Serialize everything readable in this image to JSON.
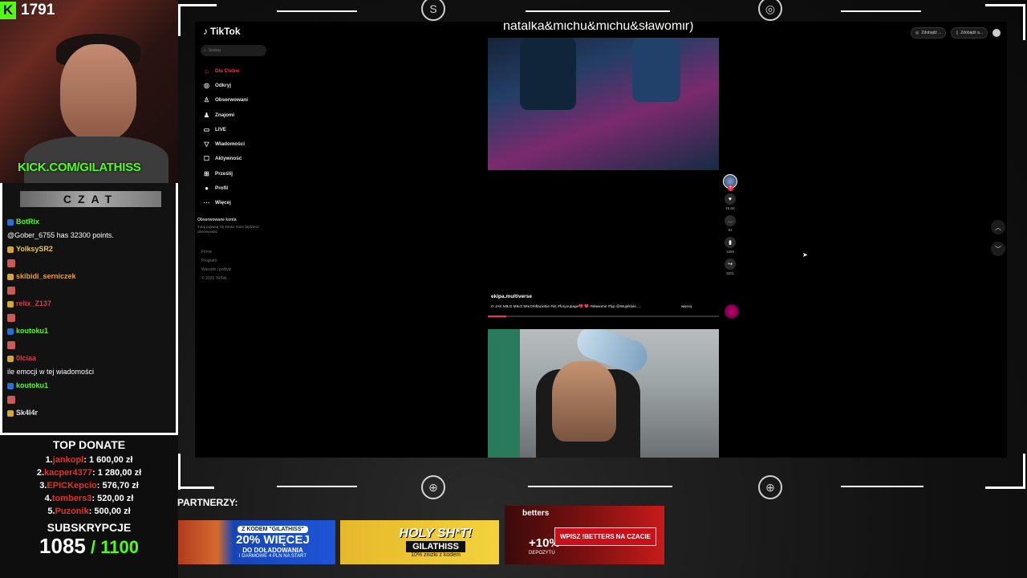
{
  "kick": {
    "viewers": "1791",
    "url": "KICK.COM/GILATHISS"
  },
  "chat": {
    "header": "CZAT",
    "lines": [
      {
        "user": "BotRix",
        "color": "#53fc18",
        "text": ""
      },
      {
        "user": "",
        "color": "#fff",
        "text": "@Gober_6755 has 32300 points."
      },
      {
        "user": "YolksySR2",
        "color": "#e8c84a",
        "text": ""
      },
      {
        "user": "",
        "color": "#fff",
        "text": ""
      },
      {
        "user": "skibidi_serniczek",
        "color": "#e8a040",
        "text": ""
      },
      {
        "user": "",
        "color": "#fff",
        "text": ""
      },
      {
        "user": "relix_Z137",
        "color": "#d83a4a",
        "text": ""
      },
      {
        "user": "",
        "color": "#fff",
        "text": ""
      },
      {
        "user": "koutoku1",
        "color": "#53fc18",
        "text": ""
      },
      {
        "user": "",
        "color": "#fff",
        "text": ""
      },
      {
        "user": "0lciaa",
        "color": "#d83a4a",
        "text": ""
      },
      {
        "user": "",
        "color": "#fff",
        "text": "ile emocji w tej wiadomości"
      },
      {
        "user": "koutoku1",
        "color": "#53fc18",
        "text": ""
      },
      {
        "user": "",
        "color": "#fff",
        "text": ""
      },
      {
        "user": "Sk4l4r",
        "color": "#e0e0e0",
        "text": ""
      }
    ]
  },
  "donate": {
    "title": "TOP DONATE",
    "items": [
      {
        "rank": "1.",
        "name": "jankopl",
        "amount": ": 1 600,00 zł"
      },
      {
        "rank": "2.",
        "name": "kacper4377",
        "amount": ": 1 280,00 zł"
      },
      {
        "rank": "3.",
        "name": "EPICKepcio",
        "amount": ": 576,70 zł"
      },
      {
        "rank": "4.",
        "name": "tombers3",
        "amount": ": 520,00 zł"
      },
      {
        "rank": "5.",
        "name": "Puzonik",
        "amount": ": 500,00 zł"
      }
    ],
    "subs_title": "SUBSKRYPCJE",
    "subs_current": "1085",
    "subs_goal": " / 1100"
  },
  "tiktok": {
    "logo": "TikTok",
    "search_placeholder": "Szukaj",
    "nav": [
      {
        "icon": "⌂",
        "label": "Dla Ciebie",
        "active": true
      },
      {
        "icon": "◎",
        "label": "Odkryj"
      },
      {
        "icon": "♙",
        "label": "Obserwowani"
      },
      {
        "icon": "♟",
        "label": "Znajomi"
      },
      {
        "icon": "▭",
        "label": "LIVE"
      },
      {
        "icon": "▽",
        "label": "Wiadomości"
      },
      {
        "icon": "☐",
        "label": "Aktywność"
      },
      {
        "icon": "⊞",
        "label": "Prześlij"
      },
      {
        "icon": "●",
        "label": "Profil"
      },
      {
        "icon": "⋯",
        "label": "Więcej"
      }
    ],
    "followed_title": "Obserwowane konta",
    "followed_desc": "Tutaj pojawią się konta, które będziesz obserwować",
    "footer": [
      "Firma",
      "Program",
      "Warunki i polityki",
      "© 2025 TikTok"
    ],
    "top_pills": [
      "Zdobądź ...",
      "Zdobądź a..."
    ],
    "video_title": "natalka&michu&michu&sławomir)",
    "actions": [
      {
        "icon": "♥",
        "count": "19,6K"
      },
      {
        "icon": "…",
        "count": "93"
      },
      {
        "icon": "▮",
        "count": "1659"
      },
      {
        "icon": "↪",
        "count": "2601"
      }
    ],
    "author": "ekipa.multiverse",
    "caption": "O JAK MIŁO MIŁO MIŁO#dlaciebie #dc #foryoupage💔 ❤️ #sławomir #fyp @Wujekluki ...",
    "more": "więcej",
    "progress": 0.08
  },
  "partners": {
    "label": "PARTNERZY:",
    "ad1": {
      "code": "Z KODEM \"GILATHISS\"",
      "big": "20% WIĘCEJ",
      "sub": "DO DOŁADOWANIA",
      "small": "I DARMOWE 4 PLN NA START"
    },
    "ad2": {
      "big": "HOLY SH*T!",
      "code": "GILATHISS",
      "small": "10% zniżki z kodem"
    },
    "ad3": {
      "brand": "betters",
      "pct": "+10%",
      "dep": "DEPOZYTU",
      "cta": "WPISZ !BETTERS NA CZACIE"
    }
  }
}
